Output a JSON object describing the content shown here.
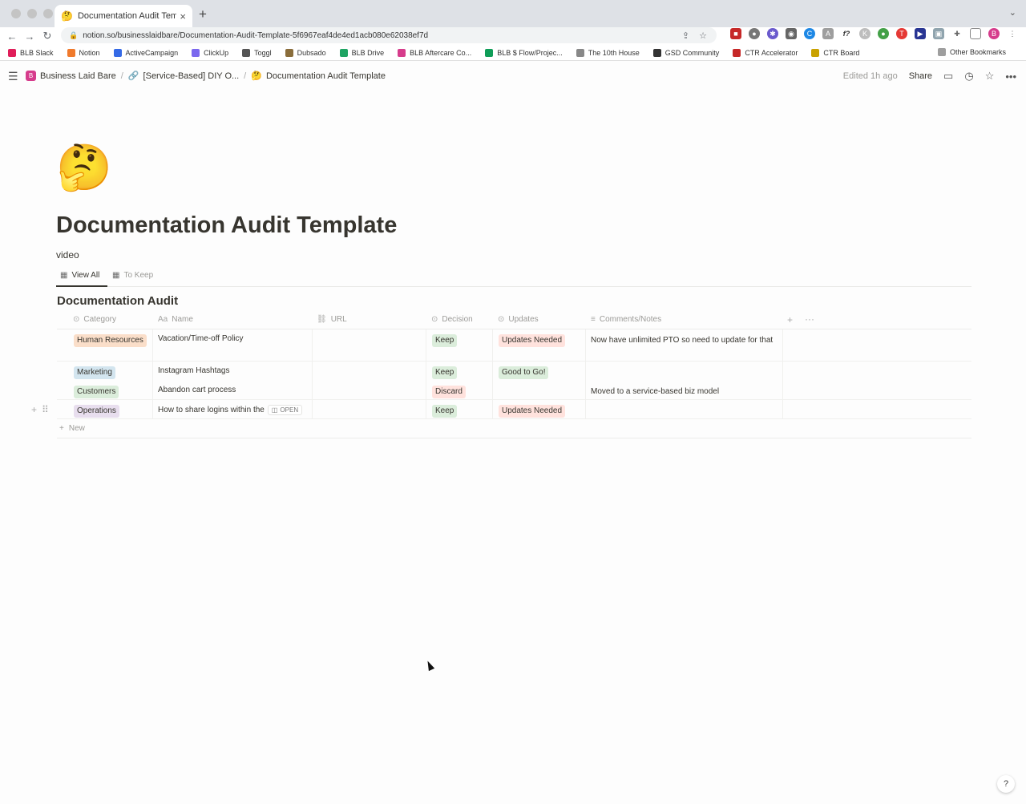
{
  "browser": {
    "tab_title": "Documentation Audit Template",
    "tab_favicon": "🤔",
    "url": "notion.so/businesslaidbare/Documentation-Audit-Template-5f6967eaf4de4ed1acb080e62038ef7d",
    "bookmarks": [
      {
        "label": "BLB Slack",
        "color": "#e01e5a"
      },
      {
        "label": "Notion",
        "color": "#f07a2c"
      },
      {
        "label": "ActiveCampaign",
        "color": "#356ae6"
      },
      {
        "label": "ClickUp",
        "color": "#7b68ee"
      },
      {
        "label": "Toggl",
        "color": "#555555"
      },
      {
        "label": "Dubsado",
        "color": "#8a6d3b"
      },
      {
        "label": "BLB Drive",
        "color": "#1fa463"
      },
      {
        "label": "BLB Aftercare Co...",
        "color": "#d63c8c"
      },
      {
        "label": "BLB $ Flow/Projec...",
        "color": "#0f9d58"
      },
      {
        "label": "The 10th House",
        "color": "#888888"
      },
      {
        "label": "GSD Community",
        "color": "#333333"
      },
      {
        "label": "CTR Accelerator",
        "color": "#c62828"
      },
      {
        "label": "CTR Board",
        "color": "#c9a100"
      }
    ],
    "other_bookmarks": "Other Bookmarks"
  },
  "notion": {
    "breadcrumbs": [
      "Business Laid Bare",
      "[Service-Based] DIY O...",
      "Documentation Audit Template"
    ],
    "edited": "Edited 1h ago",
    "share": "Share"
  },
  "page": {
    "emoji": "🤔",
    "title": "Documentation Audit Template",
    "description": "video",
    "views": [
      "View All",
      "To Keep"
    ],
    "db_title": "Documentation Audit",
    "columns": [
      "Category",
      "Name",
      "URL",
      "Decision",
      "Updates",
      "Comments/Notes"
    ],
    "rows": [
      {
        "category": "Human Resources",
        "name": "Vacation/Time-off Policy",
        "decision": "Keep",
        "updates": "Updates Needed",
        "notes": "Now have unlimited PTO so need to update for that"
      },
      {
        "category": "Marketing",
        "name": "Instagram Hashtags",
        "decision": "Keep",
        "updates": "Good to Go!",
        "notes": ""
      },
      {
        "category": "Customers",
        "name": "Abandon cart process",
        "decision": "Discard",
        "updates": "",
        "notes": "Moved to a service-based biz model"
      },
      {
        "category": "Operations",
        "name": "How to share logins within the",
        "decision": "Keep",
        "updates": "Updates Needed",
        "notes": "",
        "open_label": "OPEN"
      }
    ],
    "new_label": "New"
  },
  "colors": {
    "hr_bg": "#fadec9",
    "marketing_bg": "#d3e5ef",
    "customers_bg": "#dbeddb",
    "operations_bg": "#e8deee",
    "keep_bg": "#dbeddb",
    "discard_bg": "#ffe2dd",
    "updates_needed_bg": "#ffe2dd",
    "good_bg": "#dbeddb"
  },
  "help": "?"
}
